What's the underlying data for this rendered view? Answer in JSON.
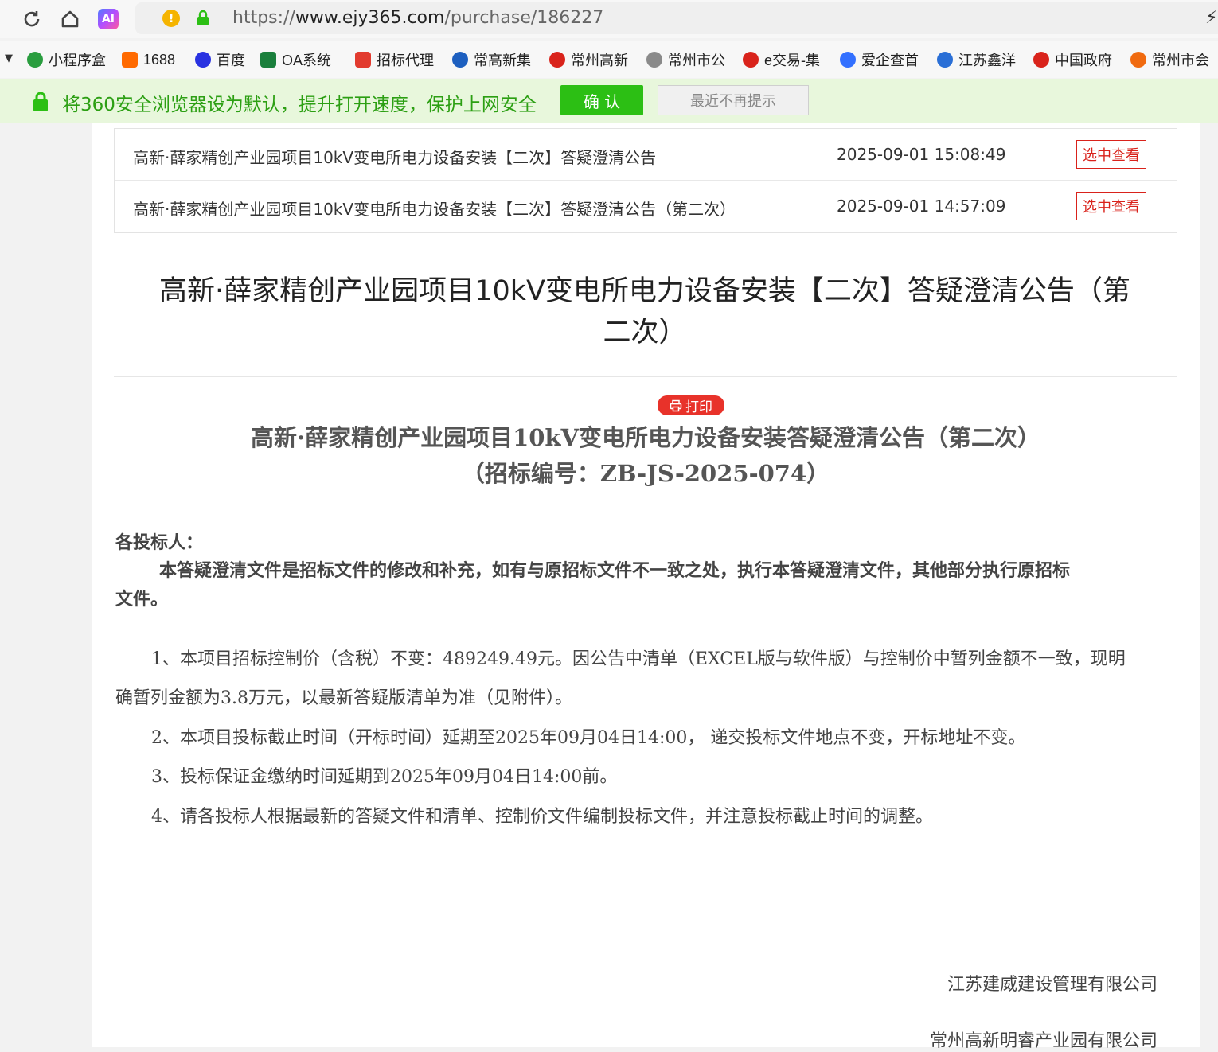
{
  "browser": {
    "url_prefix": "https://",
    "url_domain": "www.ejy365.com",
    "url_path": "/purchase/186227",
    "ai_label": "AI"
  },
  "bookmarks": [
    {
      "label": "小程序盒",
      "icon": "miniprogram-icon",
      "color": "#2a9d3f"
    },
    {
      "label": "1688",
      "icon": "alibaba-icon",
      "color": "#ff6a00"
    },
    {
      "label": "百度",
      "icon": "baidu-paw-icon",
      "color": "#2932e1"
    },
    {
      "label": "OA系统",
      "icon": "oa-icon",
      "color": "#1a7f3c"
    },
    {
      "label": "招标代理",
      "icon": "pdf-icon",
      "color": "#e23b2f"
    },
    {
      "label": "常高新集",
      "icon": "chgx-icon",
      "color": "#1d5fbf"
    },
    {
      "label": "常州高新",
      "icon": "czgx-seal-icon",
      "color": "#d9231b"
    },
    {
      "label": "常州市公",
      "icon": "globe-icon",
      "color": "#8a8a8a"
    },
    {
      "label": "e交易-集",
      "icon": "ejy-icon",
      "color": "#d9231b"
    },
    {
      "label": "爱企查首",
      "icon": "aiqicha-icon",
      "color": "#3370ff"
    },
    {
      "label": "江苏鑫洋",
      "icon": "xinyang-icon",
      "color": "#2a6fd6"
    },
    {
      "label": "中国政府",
      "icon": "national-emblem-icon",
      "color": "#d9231b"
    },
    {
      "label": "常州市会",
      "icon": "czsh-icon",
      "color": "#f06a0f"
    }
  ],
  "banner": {
    "text": "将360安全浏览器设为默认，提升打开速度，保护上网安全",
    "confirm": "确 认",
    "dismiss": "最近不再提示"
  },
  "notices": [
    {
      "title": "高新·薛家精创产业园项目10kV变电所电力设备安装【二次】答疑澄清公告",
      "time": "2025-09-01 15:08:49",
      "action": "选中查看"
    },
    {
      "title": "高新·薛家精创产业园项目10kV变电所电力设备安装【二次】答疑澄清公告（第二次）",
      "time": "2025-09-01 14:57:09",
      "action": "选中查看"
    }
  ],
  "page": {
    "title_line1": "高新·薛家精创产业园项目10kV变电所电力设备安装【二次】答疑澄清公告（第",
    "title_line2": "二次）",
    "print": "打印"
  },
  "doc": {
    "heading": "高新·薛家精创产业园项目10kV变电所电力设备安装答疑澄清公告（第二次）",
    "code": "（招标编号：ZB-JS-2025-074）",
    "salutation": "各投标人：",
    "intro_line1": "本答疑澄清文件是招标文件的修改和补充，如有与原招标文件不一致之处，执行本答疑澄清文件，其他部分执行原招标",
    "intro_line2": "文件。",
    "item1_line1": "1、本项目招标控制价（含税）不变：489249.49元。因公告中清单（EXCEL版与软件版）与控制价中暂列金额不一致，现明",
    "item1_line2": "确暂列金额为3.8万元，以最新答疑版清单为准（见附件）。",
    "item2": "2、本项目投标截止时间（开标时间）延期至2025年09月04日14:00， 递交投标文件地点不变，开标地址不变。",
    "item3": "3、投标保证金缴纳时间延期到2025年09月04日14:00前。",
    "item4": "4、请各投标人根据最新的答疑文件和清单、控制价文件编制投标文件，并注意投标截止时间的调整。",
    "sign1": "江苏建威建设管理有限公司",
    "sign2": "常州高新明睿产业园有限公司"
  }
}
